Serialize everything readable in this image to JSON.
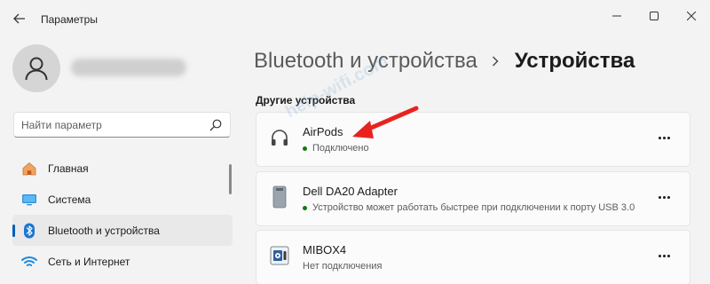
{
  "window": {
    "title": "Параметры",
    "back_icon": "arrow-left-icon",
    "controls": [
      "minimize-icon",
      "maximize-icon",
      "close-icon"
    ]
  },
  "sidebar": {
    "search": {
      "placeholder": "Найти параметр",
      "value": "",
      "icon": "search-icon"
    },
    "items": [
      {
        "label": "Главная",
        "icon": "home-icon",
        "active": false
      },
      {
        "label": "Система",
        "icon": "monitor-icon",
        "active": false
      },
      {
        "label": "Bluetooth и устройства",
        "icon": "bluetooth-icon",
        "active": true
      },
      {
        "label": "Сеть и Интернет",
        "icon": "wifi-icon",
        "active": false
      }
    ]
  },
  "main": {
    "breadcrumb": {
      "parent": "Bluetooth и устройства",
      "separator_icon": "chevron-right-icon",
      "current": "Устройства"
    },
    "section_title": "Другие устройства",
    "devices": [
      {
        "name": "AirPods",
        "status": "Подключено",
        "icon": "headphones-icon",
        "status_dot": true,
        "dot_color": "#0f7b0f"
      },
      {
        "name": "Dell DA20 Adapter",
        "status": "Устройство может работать быстрее при подключении к порту USB 3.0",
        "icon": "usb-adapter-icon",
        "status_dot": true,
        "dot_color": "#0f7b0f"
      },
      {
        "name": "MIBOX4",
        "status": "Нет подключения",
        "icon": "media-player-icon",
        "status_dot": false
      }
    ],
    "more_icon": "more-horizontal-icon"
  },
  "overlay": {
    "watermark": "help-wifi.com",
    "arrow_color": "#e8231f"
  },
  "colors": {
    "accent": "#005fb8",
    "background": "#f3f3f3",
    "card": "#fbfbfb",
    "connected": "#0f7b0f"
  }
}
